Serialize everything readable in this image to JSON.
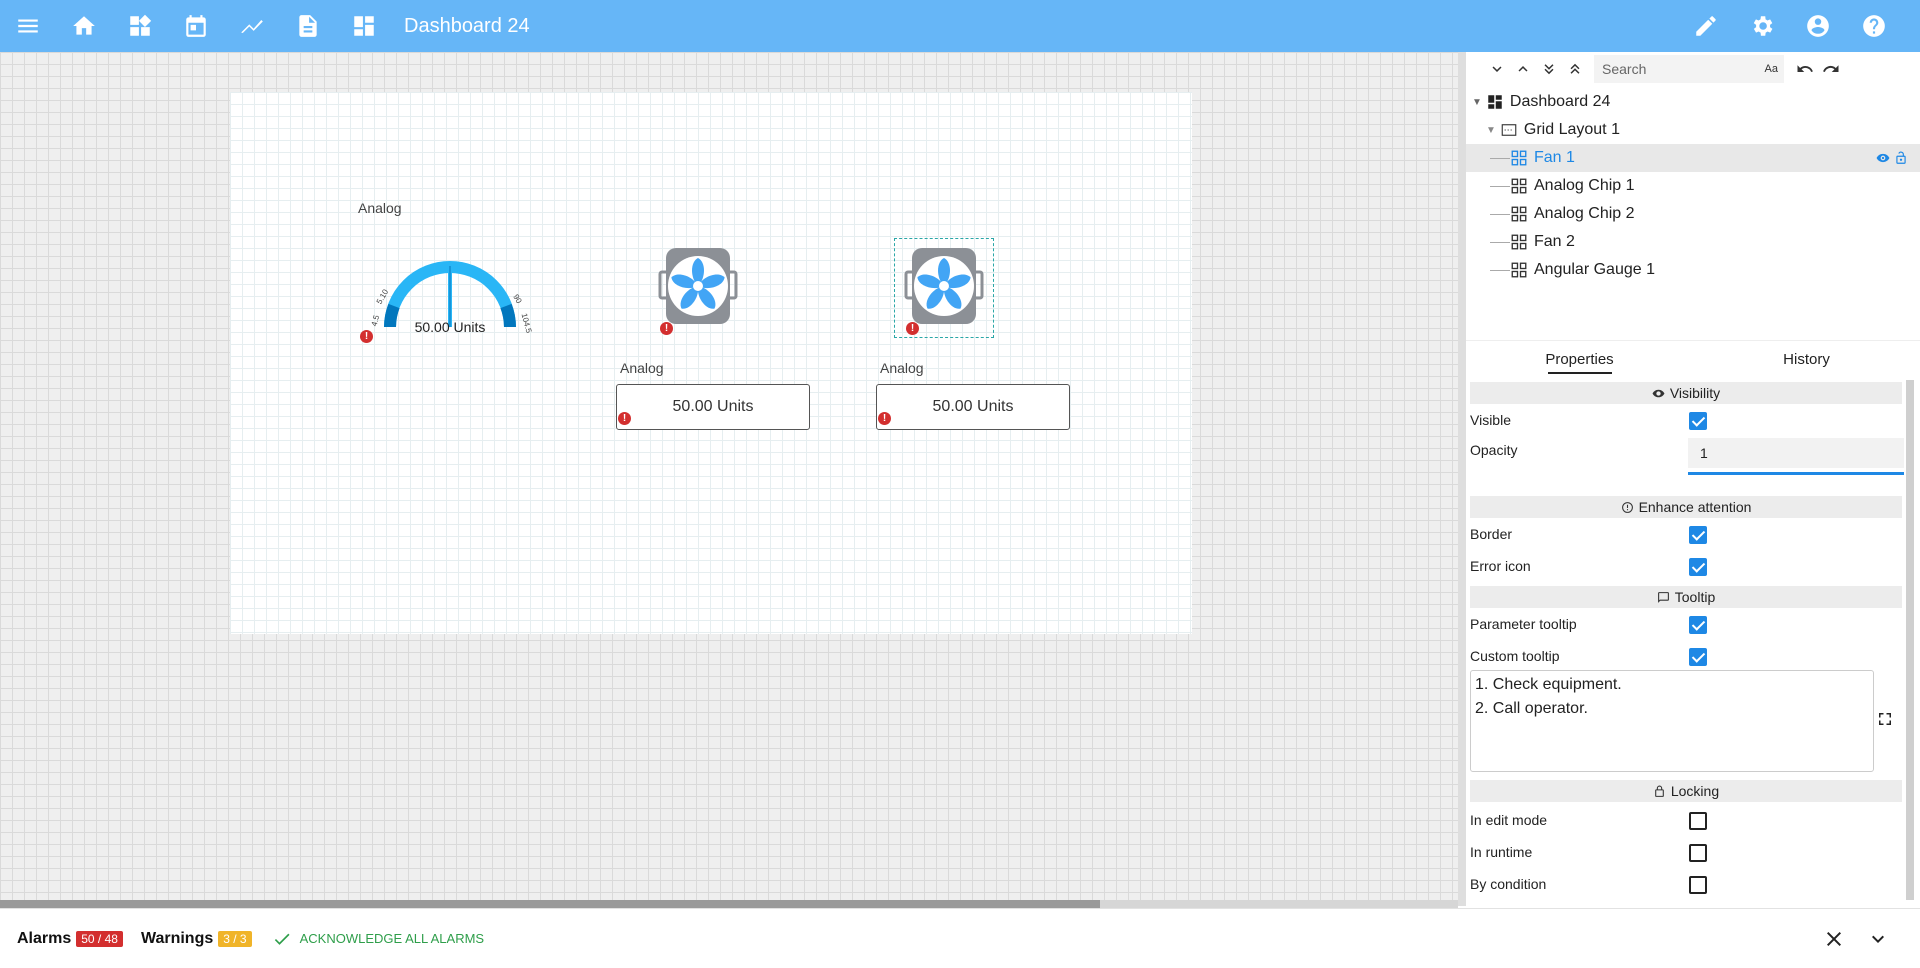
{
  "topbar": {
    "title": "Dashboard 24",
    "left_icons": [
      "menu-icon",
      "home-icon",
      "widgets-icon",
      "calendar-icon",
      "chart-icon",
      "document-icon",
      "dashboard-icon"
    ],
    "right_icons": [
      "edit-icon",
      "settings-icon",
      "account-icon",
      "help-icon"
    ]
  },
  "canvas": {
    "gauge": {
      "label": "Analog",
      "value_text": "50.00 Units",
      "tick_labels": [
        "4.5",
        "5.10",
        "90",
        "104.5"
      ],
      "arc_color": "#29b6f6",
      "arc_dark": "#0277bd"
    },
    "fan1": {
      "label": "Fan 1"
    },
    "fan2": {
      "label": "Fan 2"
    },
    "chip1": {
      "label": "Analog",
      "value_text": "50.00 Units"
    },
    "chip2": {
      "label": "Analog",
      "value_text": "50.00 Units"
    },
    "error_glyph": "!"
  },
  "tree_toolbar": {
    "search_placeholder": "Search",
    "case_toggle": "Aa"
  },
  "tree": {
    "root": "Dashboard 24",
    "layout": "Grid Layout 1",
    "items": [
      "Fan 1",
      "Analog Chip 1",
      "Analog Chip 2",
      "Fan 2",
      "Angular Gauge 1"
    ],
    "selected": "Fan 1"
  },
  "tabs": [
    "Properties",
    "History"
  ],
  "props": {
    "visibility": {
      "title": "Visibility",
      "visible_label": "Visible",
      "visible": true,
      "opacity_label": "Opacity",
      "opacity_value": "1"
    },
    "attention": {
      "title": "Enhance attention",
      "border_label": "Border",
      "border": true,
      "error_icon_label": "Error icon",
      "error_icon": true
    },
    "tooltip": {
      "title": "Tooltip",
      "param_label": "Parameter tooltip",
      "param": true,
      "custom_label": "Custom tooltip",
      "custom": true,
      "lines": [
        "1. Check equipment.",
        "2. Call operator."
      ]
    },
    "locking": {
      "title": "Locking",
      "edit_label": "In edit mode",
      "edit": false,
      "runtime_label": "In runtime",
      "runtime": false,
      "cond_label": "By condition",
      "cond": false
    }
  },
  "bottombar": {
    "alarms_label": "Alarms",
    "alarms_count": "50 / 48",
    "warnings_label": "Warnings",
    "warnings_count": "3 / 3",
    "ack_label": "ACKNOWLEDGE ALL ALARMS"
  }
}
